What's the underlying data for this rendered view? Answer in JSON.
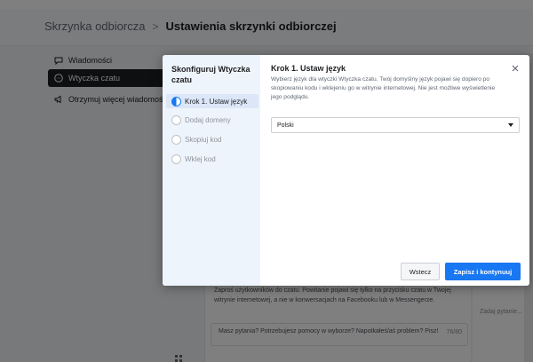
{
  "breadcrumb": {
    "root": "Skrzynka odbiorcza",
    "separator": ">",
    "current": "Ustawienia skrzynki odbiorczej"
  },
  "sidebar": {
    "items": [
      {
        "label": "Wiadomości",
        "icon": "chat-bubble-icon",
        "active": false
      },
      {
        "label": "Wtyczka czatu",
        "icon": "messenger-icon",
        "active": true
      },
      {
        "label": "Otrzymuj więcej wiadomości",
        "icon": "megaphone-icon",
        "active": false
      }
    ]
  },
  "background_content": {
    "text": "Zaproś użytkowników do czatu. Powitanie pojawi się tylko na przycisku czatu w Twojej witrynie internetowej, a nie w konwersacjach na Facebooku lub w Messengerze.",
    "question_text": "Masz pytania? Potrzebujesz pomocy w wyborze? Napotkałeś/aś problem? Pisz!",
    "counter": "76/80",
    "ask_placeholder": "Zadaj pytanie..."
  },
  "modal": {
    "steps_title": "Skonfiguruj Wtyczka czatu",
    "steps": [
      {
        "label": "Krok 1. Ustaw język",
        "active": true
      },
      {
        "label": "Dodaj domeny",
        "active": false
      },
      {
        "label": "Skopiuj kod",
        "active": false
      },
      {
        "label": "Wklej kod",
        "active": false
      }
    ],
    "heading": "Krok 1. Ustaw język",
    "description": "Wybierz język dla wtyczki Wtyczka czatu. Twój domyślny język pojawi się dopiero po skopiowaniu kodu i wklejeniu go w witrynie internetowej. Nie jest możliwe wyświetlenie jego podglądu.",
    "close_symbol": "×",
    "language_select": {
      "selected": "Polski"
    },
    "back_label": "Wstecz",
    "save_label": "Zapisz i kontynuuj"
  },
  "colors": {
    "accent": "#1877f2",
    "steps_bg": "#eef4fb",
    "active_sidebar_bg": "#1c1e21"
  }
}
